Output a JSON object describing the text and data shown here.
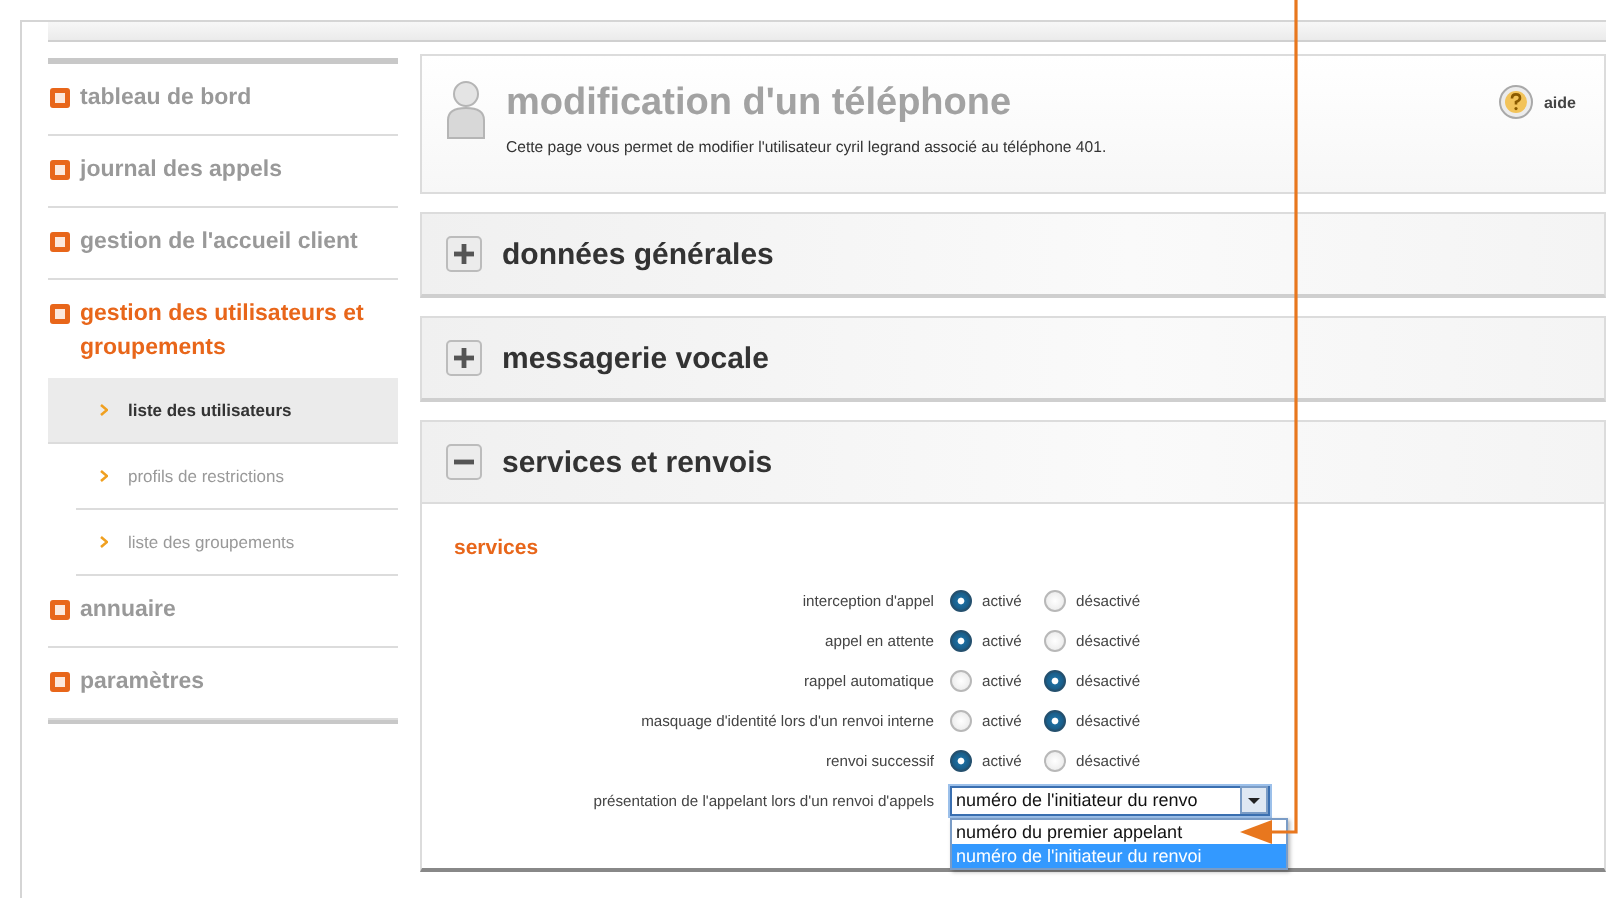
{
  "sidebar": {
    "items": [
      {
        "label": "tableau de bord",
        "selected": false
      },
      {
        "label": "journal des appels",
        "selected": false
      },
      {
        "label": "gestion de l'accueil client",
        "selected": false
      },
      {
        "label": "gestion des utilisateurs et groupements",
        "selected": true,
        "children": [
          {
            "label": "liste des utilisateurs",
            "selected": true
          },
          {
            "label": "profils de restrictions",
            "selected": false
          },
          {
            "label": "liste des groupements",
            "selected": false
          }
        ]
      },
      {
        "label": "annuaire",
        "selected": false
      },
      {
        "label": "paramètres",
        "selected": false
      }
    ]
  },
  "header": {
    "title": "modification d'un téléphone",
    "description": "Cette page vous permet de modifier l'utilisateur cyril legrand associé au téléphone 401.",
    "help": "aide"
  },
  "sections": [
    {
      "title": "données générales",
      "expanded": false
    },
    {
      "title": "messagerie vocale",
      "expanded": false
    },
    {
      "title": "services et renvois",
      "expanded": true
    }
  ],
  "services": {
    "heading": "services",
    "rows": [
      {
        "kind": "radio",
        "label": "interception d'appel",
        "options": [
          {
            "label": "activé",
            "selected": true
          },
          {
            "label": "désactivé",
            "selected": false
          }
        ]
      },
      {
        "kind": "radio",
        "label": "appel en attente",
        "options": [
          {
            "label": "activé",
            "selected": true
          },
          {
            "label": "désactivé",
            "selected": false
          }
        ]
      },
      {
        "kind": "radio",
        "label": "rappel automatique",
        "options": [
          {
            "label": "activé",
            "selected": false
          },
          {
            "label": "désactivé",
            "selected": true
          }
        ]
      },
      {
        "kind": "radio",
        "label": "masquage d'identité lors d'un renvoi interne",
        "options": [
          {
            "label": "activé",
            "selected": false
          },
          {
            "label": "désactivé",
            "selected": true
          }
        ]
      },
      {
        "kind": "radio",
        "label": "renvoi successif",
        "options": [
          {
            "label": "activé",
            "selected": true
          },
          {
            "label": "désactivé",
            "selected": false
          }
        ]
      },
      {
        "kind": "select",
        "label": "présentation de l'appelant lors d'un renvoi d'appels",
        "value": "numéro de l'initiateur du renvo",
        "expanded": true,
        "options": [
          {
            "label": "numéro du premier appelant",
            "selected": false
          },
          {
            "label": "numéro de l'initiateur du renvoi",
            "selected": true
          }
        ]
      }
    ]
  }
}
